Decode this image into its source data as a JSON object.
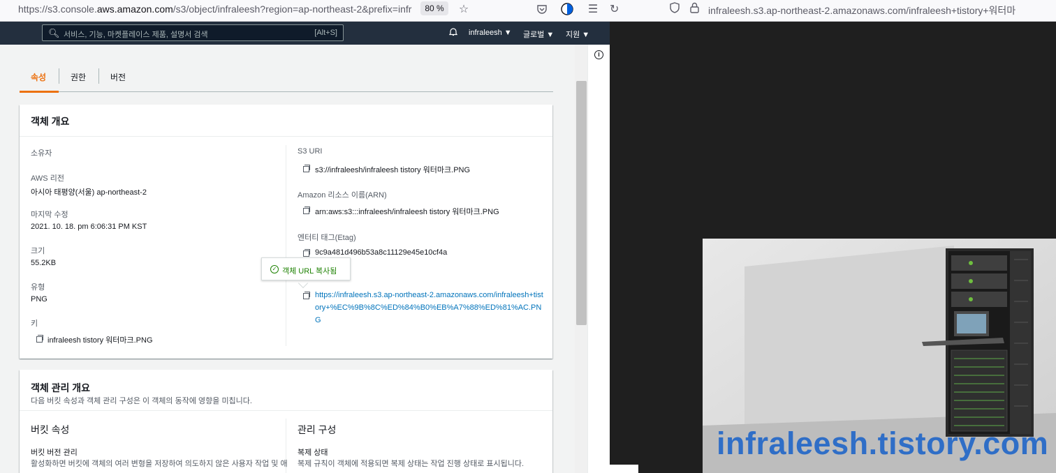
{
  "left_browser": {
    "url_prefix": "https://s3.console.",
    "url_domain": "aws.amazon.com",
    "url_rest": "/s3/object/infraleesh?region=ap-northeast-2&prefix=infr",
    "zoom": "80 %"
  },
  "aws_nav": {
    "search_placeholder": "서비스, 기능, 마켓플레이스 제품, 설명서 검색",
    "search_shortcut": "[Alt+S]",
    "account": "infraleesh ▼",
    "region": "글로벌 ▼",
    "support": "지원 ▼"
  },
  "tabs": [
    {
      "label": "속성",
      "active": true
    },
    {
      "label": "권한",
      "active": false
    },
    {
      "label": "버전",
      "active": false
    }
  ],
  "object_overview": {
    "title": "객체 개요",
    "owner_label": "소유자",
    "region_label": "AWS 리전",
    "region_value": "아시아 태평양(서울) ap-northeast-2",
    "modified_label": "마지막 수정",
    "modified_value": "2021. 10. 18. pm 6:06:31 PM KST",
    "size_label": "크기",
    "size_value": "55.2KB",
    "type_label": "유형",
    "type_value": "PNG",
    "key_label": "키",
    "key_value": "infraleesh tistory 워터마크.PNG",
    "s3uri_label": "S3 URI",
    "s3uri_value": "s3://infraleesh/infraleesh tistory 워터마크.PNG",
    "arn_label": "Amazon 리소스 이름(ARN)",
    "arn_value": "arn:aws:s3:::infraleesh/infraleesh tistory 워터마크.PNG",
    "etag_label": "엔터티 태그(Etag)",
    "etag_value": "9c9a481d496b53a8c11129e45e10cf4a",
    "url_value": "https://infraleesh.s3.ap-northeast-2.amazonaws.com/infraleesh+tistory+%EC%9B%8C%ED%84%B0%EB%A7%88%ED%81%AC.PNG",
    "tooltip": "객체 URL 복사됨"
  },
  "mgmt_overview": {
    "title": "객체 관리 개요",
    "desc": "다음 버킷 속성과 객체 관리 구성은 이 객체의 동작에 영향을 미칩니다.",
    "bucket_props": "버킷 속성",
    "versioning_label": "버킷 버전 관리",
    "versioning_desc": "활성화하면 버킷에 객체의 여러 변형을 저장하여 의도하지 않은 사용자 작업 및 애",
    "mgmt_config": "관리 구성",
    "replication_label": "복제 상태",
    "replication_desc": "복제 규칙이 객체에 적용되면 복제 상태는 작업 진행 상태로 표시됩니다."
  },
  "right_browser": {
    "url_domain": "infraleesh.s3.ap-northeast-2.amazonaws.com",
    "url_rest": "/infraleesh+tistory+워터마"
  },
  "watermark_image": {
    "text": "infraleesh.tistory.com",
    "text_color": "#2f6ec7"
  }
}
